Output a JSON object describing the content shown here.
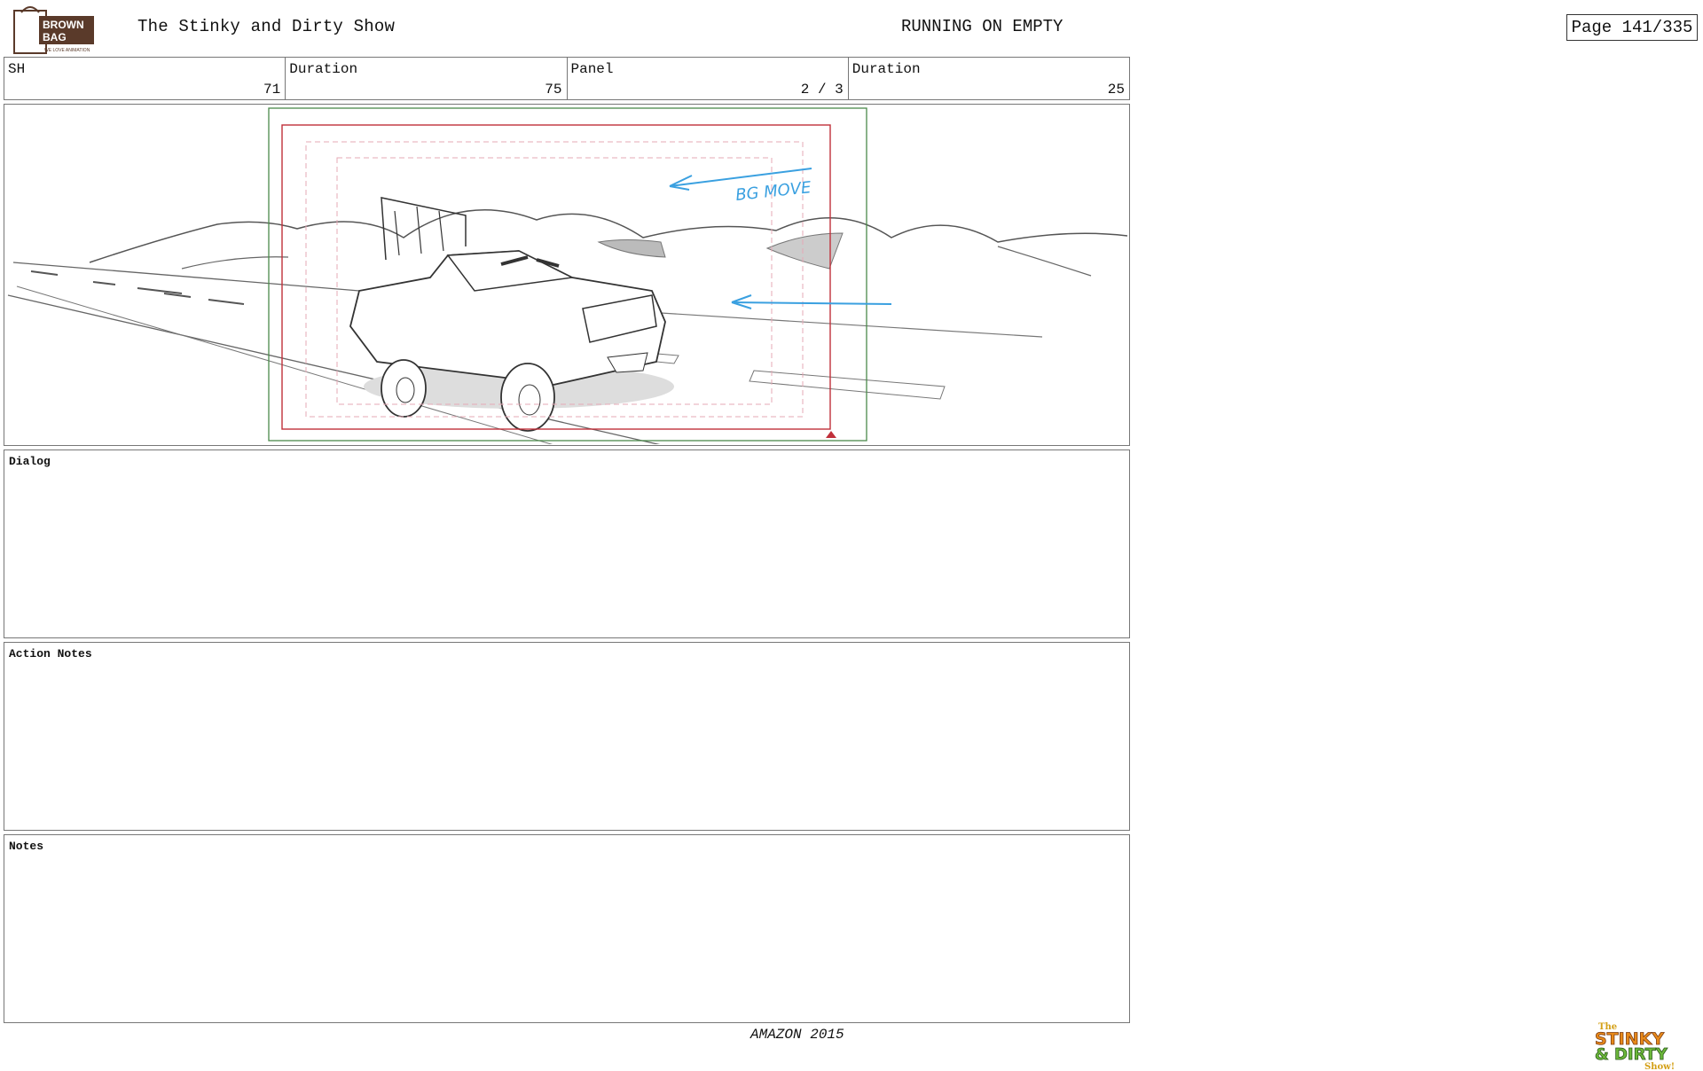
{
  "header": {
    "logo_brown": "BROWN",
    "logo_bag": "BAG",
    "logo_tagline": "WE LOVE ANIMATION",
    "show_title": "The Stinky and Dirty Show",
    "episode_title": "RUNNING ON EMPTY",
    "page": "Page 141/335"
  },
  "info": {
    "sh_label": "SH",
    "sh_value": "71",
    "duration1_label": "Duration",
    "duration1_value": "75",
    "panel_label": "Panel",
    "panel_value": "2 / 3",
    "duration2_label": "Duration",
    "duration2_value": "25"
  },
  "panel": {
    "annotation": "BG MOVE"
  },
  "sections": {
    "dialog": "Dialog",
    "action_notes": "Action Notes",
    "notes": "Notes"
  },
  "footer": {
    "text": "AMAZON 2015"
  },
  "logo_sd": {
    "line1": "The",
    "line2": "STINKY",
    "line3": "& DIRTY",
    "line4": "Show!"
  },
  "colors": {
    "safe_frame": "#4a8a4a",
    "action_frame": "#c0303a",
    "arrow_blue": "#3aa0e0",
    "logo_brown": "#5a3a2a"
  }
}
